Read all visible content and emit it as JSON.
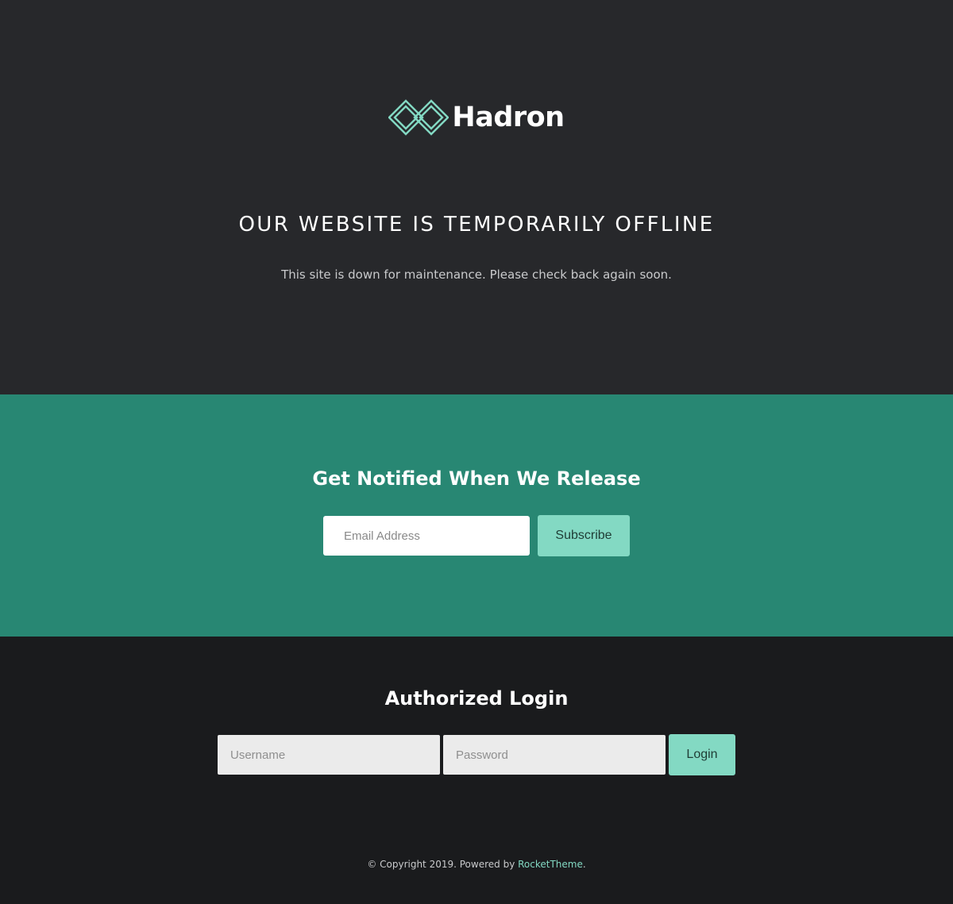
{
  "brand": {
    "name": "Hadron",
    "accent_color": "#83d9c3",
    "logo_icon": "infinity-diamond-logo-icon"
  },
  "hero": {
    "headline": "OUR WEBSITE IS TEMPORARILY OFFLINE",
    "subtext": "This site is down for maintenance. Please check back again soon."
  },
  "notify": {
    "title": "Get Notified When We Release",
    "email_placeholder": "Email Address",
    "subscribe_label": "Subscribe",
    "background_color": "#288773"
  },
  "login": {
    "title": "Authorized Login",
    "username_placeholder": "Username",
    "password_placeholder": "Password",
    "login_label": "Login"
  },
  "footer": {
    "copyright": "© Copyright 2019. Powered by ",
    "link_text": "RocketTheme",
    "suffix": "."
  }
}
